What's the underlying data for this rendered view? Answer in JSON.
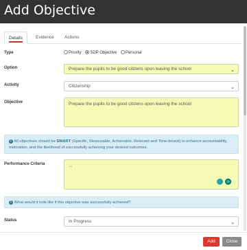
{
  "window": {
    "title": "Add Objective"
  },
  "tabs": [
    {
      "label": "Details"
    },
    {
      "label": "Evidence"
    },
    {
      "label": "Actions"
    }
  ],
  "form": {
    "type": {
      "label": "Type",
      "options": [
        "Priority",
        "SDP Objective",
        "Personal"
      ],
      "selected": "SDP Objective"
    },
    "option": {
      "label": "Option",
      "value": "Prepare the pupils to be good citizens upon leaving the school"
    },
    "activity": {
      "label": "Activity",
      "value": "Citizenship"
    },
    "objective": {
      "label": "Objective",
      "value": "Prepare the pupils to be good citizens upon leaving the school"
    },
    "smart_info": {
      "prefix": "All objectives should be ",
      "bold": "SMART",
      "suffix": " (Specific, Measurable, Achievable, Relevant and Time-bound) to enhance accountability, motivation, and the likelihood of successfully achieving your desired outcomes."
    },
    "performance": {
      "label": "Performance Criteria",
      "value": "..."
    },
    "success_info": {
      "text": "What would it look like if this objective was successfully achieved?"
    },
    "status": {
      "label": "Status",
      "value": "In Progress"
    }
  },
  "buttons": {
    "add": "Add",
    "close": "Close"
  },
  "colors": {
    "title_bar": "#333333",
    "field_yellow": "#f4fbb4",
    "info_bg": "#d9edf7",
    "add_button": "#d9392e",
    "close_button": "#8a8a8a"
  },
  "icons": {
    "grammar_1": "lightbulb-icon",
    "grammar_2": "grammarly-icon"
  }
}
